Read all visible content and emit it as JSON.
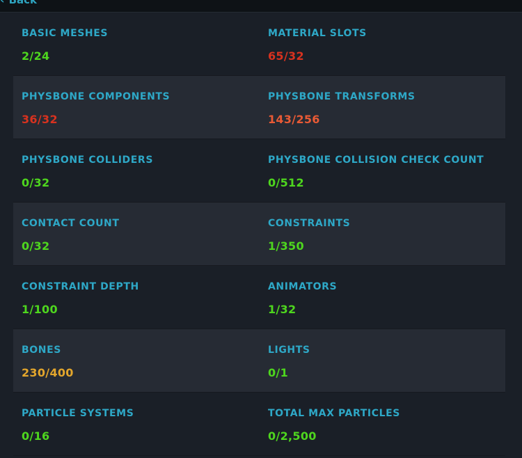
{
  "header": {
    "back_label": "Back"
  },
  "colors": {
    "label": "#2ea8c7",
    "ok": "#4ed61e",
    "bad": "#d8321f",
    "warn": "#e95a35",
    "medium": "#e3a62c",
    "row_alt_bg": "#262b34",
    "bg": "#1a1f27"
  },
  "stats": [
    {
      "left": {
        "label": "BASIC MESHES",
        "value": "2/24",
        "status": "ok"
      },
      "right": {
        "label": "MATERIAL SLOTS",
        "value": "65/32",
        "status": "bad"
      }
    },
    {
      "left": {
        "label": "PHYSBONE COMPONENTS",
        "value": "36/32",
        "status": "bad"
      },
      "right": {
        "label": "PHYSBONE TRANSFORMS",
        "value": "143/256",
        "status": "warn"
      }
    },
    {
      "left": {
        "label": "PHYSBONE COLLIDERS",
        "value": "0/32",
        "status": "ok"
      },
      "right": {
        "label": "PHYSBONE COLLISION CHECK COUNT",
        "value": "0/512",
        "status": "ok"
      }
    },
    {
      "left": {
        "label": "CONTACT COUNT",
        "value": "0/32",
        "status": "ok"
      },
      "right": {
        "label": "CONSTRAINTS",
        "value": "1/350",
        "status": "ok"
      }
    },
    {
      "left": {
        "label": "CONSTRAINT DEPTH",
        "value": "1/100",
        "status": "ok"
      },
      "right": {
        "label": "ANIMATORS",
        "value": "1/32",
        "status": "ok"
      }
    },
    {
      "left": {
        "label": "BONES",
        "value": "230/400",
        "status": "med"
      },
      "right": {
        "label": "LIGHTS",
        "value": "0/1",
        "status": "ok"
      }
    },
    {
      "left": {
        "label": "PARTICLE SYSTEMS",
        "value": "0/16",
        "status": "ok"
      },
      "right": {
        "label": "TOTAL MAX PARTICLES",
        "value": "0/2,500",
        "status": "ok"
      }
    }
  ]
}
